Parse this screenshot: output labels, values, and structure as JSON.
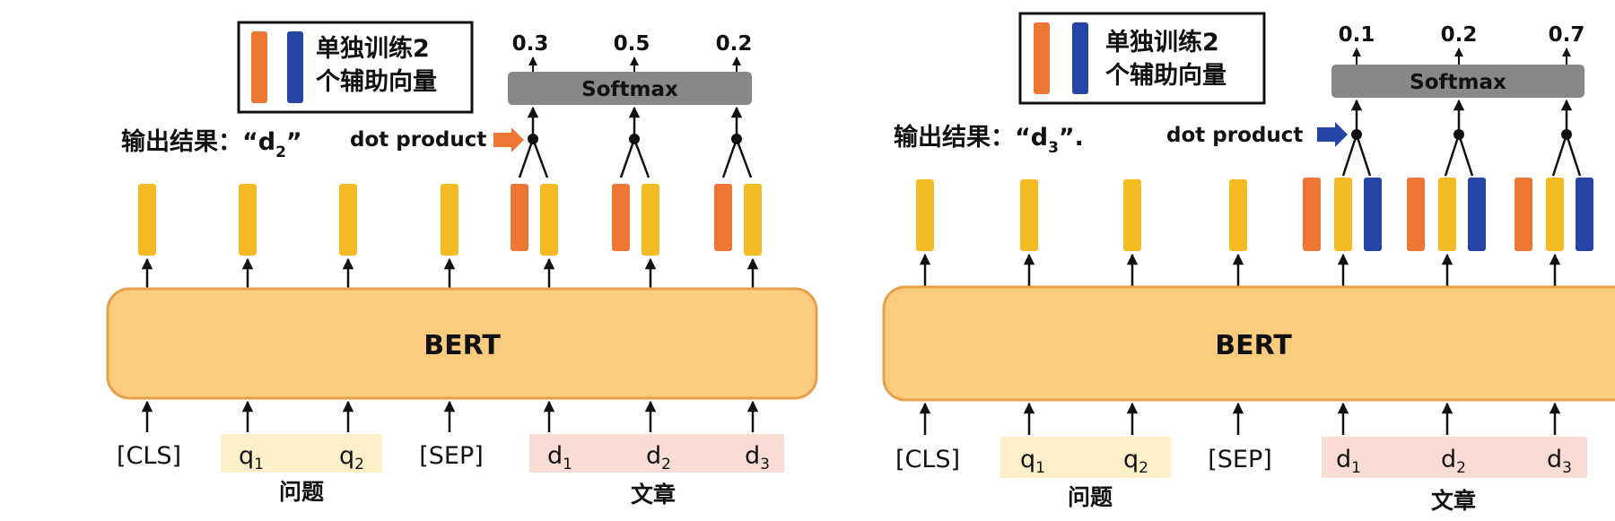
{
  "colors": {
    "yellow": "#F5BB22",
    "orange": "#EE7633",
    "blue": "#2545A6",
    "bert_fill": "#FBCB7E",
    "bert_stroke": "#E7A04A",
    "softmax": "#888888",
    "question_bg": "#FDF0C9",
    "passage_bg": "#F9DCD3"
  },
  "panels": [
    {
      "legend": {
        "line1": "单独训练2",
        "line2": "个辅助向量"
      },
      "softmax_label": "Softmax",
      "probabilities": [
        "0.3",
        "0.5",
        "0.2"
      ],
      "result_label": "输出结果：“d",
      "result_sub": "2",
      "result_suffix": "”",
      "dot_product_label": "dot product",
      "bert_label": "BERT",
      "tokens": [
        {
          "main": "[CLS]",
          "sub": ""
        },
        {
          "main": "q",
          "sub": "1"
        },
        {
          "main": "q",
          "sub": "2"
        },
        {
          "main": "[SEP]",
          "sub": ""
        },
        {
          "main": "d",
          "sub": "1"
        },
        {
          "main": "d",
          "sub": "2"
        },
        {
          "main": "d",
          "sub": "3"
        }
      ],
      "question_group": "问题",
      "passage_group": "文章"
    },
    {
      "legend": {
        "line1": "单独训练2",
        "line2": "个辅助向量"
      },
      "softmax_label": "Softmax",
      "probabilities": [
        "0.1",
        "0.2",
        "0.7"
      ],
      "result_label": "输出结果：“d",
      "result_sub": "3",
      "result_suffix": "”.",
      "dot_product_label": "dot product",
      "bert_label": "BERT",
      "tokens": [
        {
          "main": "[CLS]",
          "sub": ""
        },
        {
          "main": "q",
          "sub": "1"
        },
        {
          "main": "q",
          "sub": "2"
        },
        {
          "main": "[SEP]",
          "sub": ""
        },
        {
          "main": "d",
          "sub": "1"
        },
        {
          "main": "d",
          "sub": "2"
        },
        {
          "main": "d",
          "sub": "3"
        }
      ],
      "question_group": "问题",
      "passage_group": "文章"
    }
  ]
}
